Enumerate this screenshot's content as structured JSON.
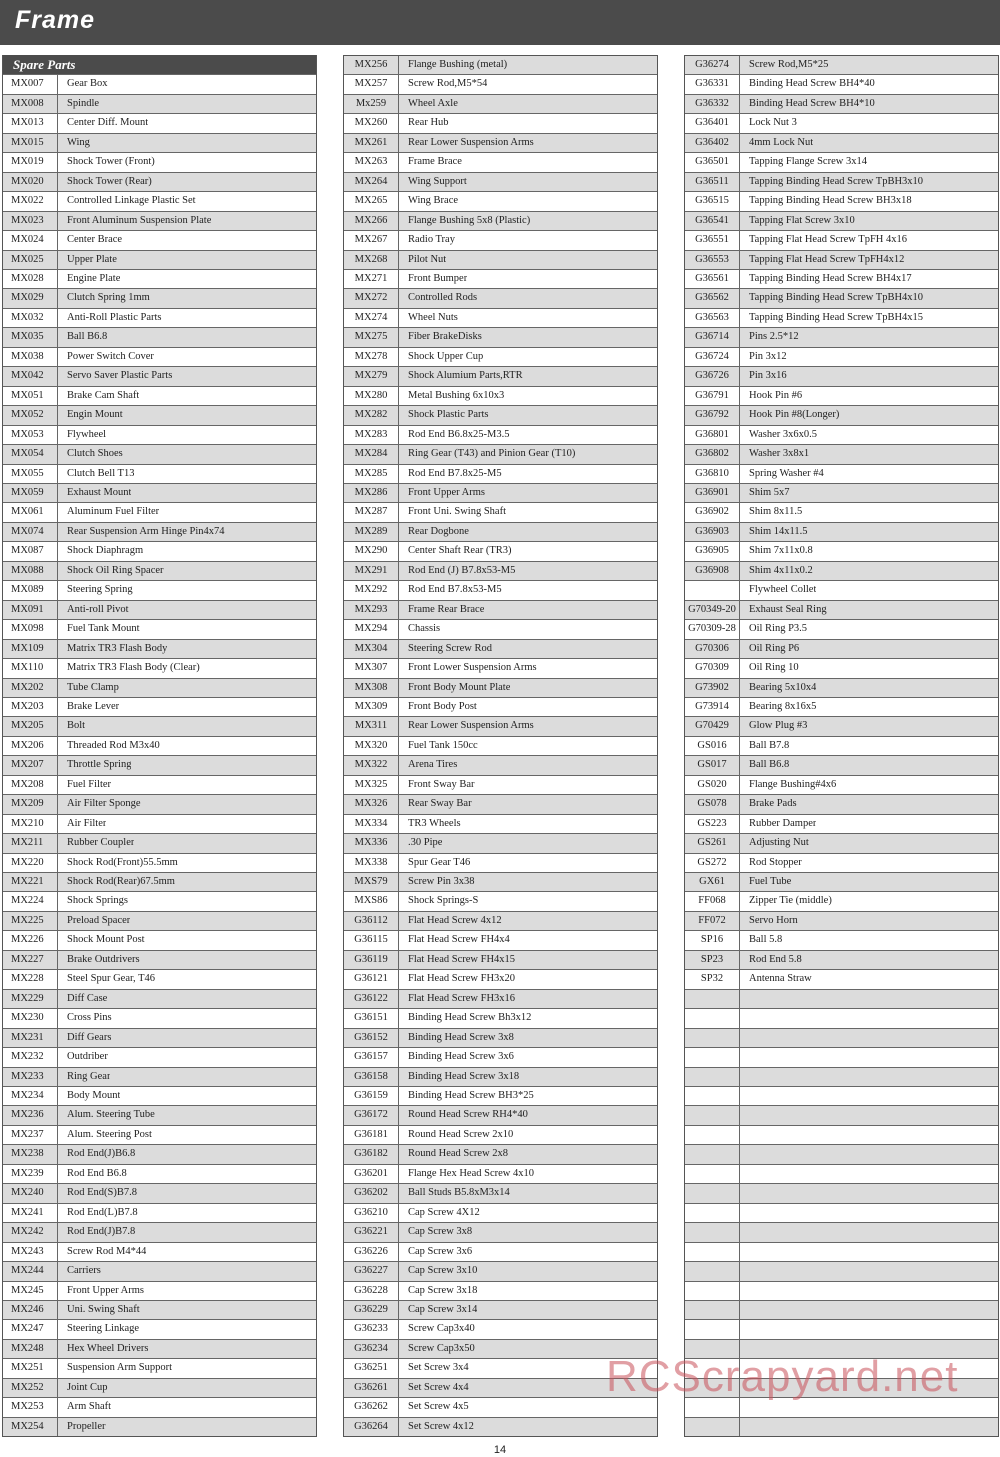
{
  "title": "Frame",
  "section_header": "Spare Parts",
  "page_number": "14",
  "watermark": "RCScrapyard.net",
  "colors": {
    "title_bar": "#4b4b4b",
    "row_shade": "#dcdcdc",
    "watermark": "#c8505a"
  },
  "columns": [
    [
      [
        "MX007",
        "Gear Box"
      ],
      [
        "MX008",
        "Spindle"
      ],
      [
        "MX013",
        "Center Diff. Mount"
      ],
      [
        "MX015",
        "Wing"
      ],
      [
        "MX019",
        "Shock Tower (Front)"
      ],
      [
        "MX020",
        "Shock Tower (Rear)"
      ],
      [
        "MX022",
        "Controlled Linkage Plastic Set"
      ],
      [
        "MX023",
        "Front Aluminum Suspension Plate"
      ],
      [
        "MX024",
        "Center Brace"
      ],
      [
        "MX025",
        "Upper Plate"
      ],
      [
        "MX028",
        "Engine Plate"
      ],
      [
        "MX029",
        "Clutch Spring 1mm"
      ],
      [
        "MX032",
        "Anti-Roll Plastic Parts"
      ],
      [
        "MX035",
        "Ball B6.8"
      ],
      [
        "MX038",
        "Power Switch Cover"
      ],
      [
        "MX042",
        "Servo Saver Plastic Parts"
      ],
      [
        "MX051",
        "Brake Cam Shaft"
      ],
      [
        "MX052",
        "Engin Mount"
      ],
      [
        "MX053",
        "Flywheel"
      ],
      [
        "MX054",
        "Clutch Shoes"
      ],
      [
        "MX055",
        "Clutch Bell T13"
      ],
      [
        "MX059",
        "Exhaust Mount"
      ],
      [
        "MX061",
        "Aluminum Fuel Filter"
      ],
      [
        "MX074",
        "Rear Suspension Arm Hinge Pin4x74"
      ],
      [
        "MX087",
        "Shock Diaphragm"
      ],
      [
        "MX088",
        "Shock Oil Ring Spacer"
      ],
      [
        "MX089",
        "Steering Spring"
      ],
      [
        "MX091",
        "Anti-roll Pivot"
      ],
      [
        "MX098",
        "Fuel Tank Mount"
      ],
      [
        "MX109",
        "Matrix TR3 Flash Body"
      ],
      [
        "MX110",
        "Matrix TR3 Flash Body (Clear)"
      ],
      [
        "MX202",
        "Tube Clamp"
      ],
      [
        "MX203",
        "Brake Lever"
      ],
      [
        "MX205",
        "Bolt"
      ],
      [
        "MX206",
        "Threaded Rod M3x40"
      ],
      [
        "MX207",
        "Throttle Spring"
      ],
      [
        "MX208",
        "Fuel Filter"
      ],
      [
        "MX209",
        "Air Filter Sponge"
      ],
      [
        "MX210",
        "Air Filter"
      ],
      [
        "MX211",
        "Rubber Coupler"
      ],
      [
        "MX220",
        "Shock Rod(Front)55.5mm"
      ],
      [
        "MX221",
        "Shock Rod(Rear)67.5mm"
      ],
      [
        "MX224",
        "Shock Springs"
      ],
      [
        "MX225",
        "Preload Spacer"
      ],
      [
        "MX226",
        "Shock Mount Post"
      ],
      [
        "MX227",
        "Brake Outdrivers"
      ],
      [
        "MX228",
        "Steel Spur Gear, T46"
      ],
      [
        "MX229",
        "Diff Case"
      ],
      [
        "MX230",
        "Cross Pins"
      ],
      [
        "MX231",
        "Diff Gears"
      ],
      [
        "MX232",
        "Outdriber"
      ],
      [
        "MX233",
        "Ring Gear"
      ],
      [
        "MX234",
        "Body Mount"
      ],
      [
        "MX236",
        "Alum. Steering Tube"
      ],
      [
        "MX237",
        "Alum. Steering Post"
      ],
      [
        "MX238",
        "Rod End(J)B6.8"
      ],
      [
        "MX239",
        "Rod End B6.8"
      ],
      [
        "MX240",
        "Rod End(S)B7.8"
      ],
      [
        "MX241",
        "Rod End(L)B7.8"
      ],
      [
        "MX242",
        "Rod End(J)B7.8"
      ],
      [
        "MX243",
        "Screw Rod M4*44"
      ],
      [
        "MX244",
        "Carriers"
      ],
      [
        "MX245",
        "Front Upper Arms"
      ],
      [
        "MX246",
        "Uni. Swing Shaft"
      ],
      [
        "MX247",
        "Steering Linkage"
      ],
      [
        "MX248",
        "Hex Wheel Drivers"
      ],
      [
        "MX251",
        "Suspension Arm Support"
      ],
      [
        "MX252",
        "Joint Cup"
      ],
      [
        "MX253",
        "Arm Shaft"
      ],
      [
        "MX254",
        "Propeller"
      ]
    ],
    [
      [
        "MX256",
        "Flange Bushing (metal)"
      ],
      [
        "MX257",
        "Screw Rod,M5*54"
      ],
      [
        "Mx259",
        "Wheel Axle"
      ],
      [
        "MX260",
        "Rear Hub"
      ],
      [
        "MX261",
        "Rear Lower Suspension Arms"
      ],
      [
        "MX263",
        "Frame Brace"
      ],
      [
        "MX264",
        "Wing Support"
      ],
      [
        "MX265",
        "Wing Brace"
      ],
      [
        "MX266",
        "Flange Bushing 5x8 (Plastic)"
      ],
      [
        "MX267",
        "Radio Tray"
      ],
      [
        "MX268",
        "Pilot Nut"
      ],
      [
        "MX271",
        "Front Bumper"
      ],
      [
        "MX272",
        "Controlled Rods"
      ],
      [
        "MX274",
        "Wheel Nuts"
      ],
      [
        "MX275",
        "Fiber BrakeDisks"
      ],
      [
        "MX278",
        "Shock Upper Cup"
      ],
      [
        "MX279",
        "Shock Alumium Parts,RTR"
      ],
      [
        "MX280",
        "Metal Bushing 6x10x3"
      ],
      [
        "MX282",
        "Shock Plastic Parts"
      ],
      [
        "MX283",
        "Rod End B6.8x25-M3.5"
      ],
      [
        "MX284",
        "Ring Gear (T43) and Pinion Gear (T10)"
      ],
      [
        "MX285",
        "Rod End B7.8x25-M5"
      ],
      [
        "MX286",
        "Front Upper Arms"
      ],
      [
        "MX287",
        "Front Uni. Swing Shaft"
      ],
      [
        "MX289",
        "Rear Dogbone"
      ],
      [
        "MX290",
        "Center Shaft Rear (TR3)"
      ],
      [
        "MX291",
        "Rod End (J) B7.8x53-M5"
      ],
      [
        "MX292",
        "Rod End B7.8x53-M5"
      ],
      [
        "MX293",
        "Frame Rear Brace"
      ],
      [
        "MX294",
        "Chassis"
      ],
      [
        "MX304",
        "Steering Screw Rod"
      ],
      [
        "MX307",
        "Front Lower Suspension Arms"
      ],
      [
        "MX308",
        "Front Body Mount  Plate"
      ],
      [
        "MX309",
        "Front Body Post"
      ],
      [
        "MX311",
        "Rear Lower Suspension Arms"
      ],
      [
        "MX320",
        "Fuel Tank 150cc"
      ],
      [
        "MX322",
        "Arena Tires"
      ],
      [
        "MX325",
        "Front Sway Bar"
      ],
      [
        "MX326",
        "Rear Sway Bar"
      ],
      [
        "MX334",
        "TR3 Wheels"
      ],
      [
        "MX336",
        ".30 Pipe"
      ],
      [
        "MX338",
        "Spur Gear T46"
      ],
      [
        "MXS79",
        "Screw Pin 3x38"
      ],
      [
        "MXS86",
        "Shock Springs-S"
      ],
      [
        "G36112",
        "Flat Head Screw 4x12"
      ],
      [
        "G36115",
        "Flat Head Screw FH4x4"
      ],
      [
        "G36119",
        "Flat Head Screw FH4x15"
      ],
      [
        "G36121",
        "Flat Head Screw FH3x20"
      ],
      [
        "G36122",
        "Flat Head Screw FH3x16"
      ],
      [
        "G36151",
        "Binding Head Screw Bh3x12"
      ],
      [
        "G36152",
        "Binding Head Screw 3x8"
      ],
      [
        "G36157",
        "Binding Head Screw 3x6"
      ],
      [
        "G36158",
        "Binding Head Screw 3x18"
      ],
      [
        "G36159",
        "Binding Head Screw BH3*25"
      ],
      [
        "G36172",
        "Round Head Screw RH4*40"
      ],
      [
        "G36181",
        "Round Head Screw 2x10"
      ],
      [
        "G36182",
        "Round Head Screw 2x8"
      ],
      [
        "G36201",
        "Flange Hex Head Screw 4x10"
      ],
      [
        "G36202",
        "Ball Studs B5.8xM3x14"
      ],
      [
        "G36210",
        "Cap Screw 4X12"
      ],
      [
        "G36221",
        "Cap Screw 3x8"
      ],
      [
        "G36226",
        "Cap Screw 3x6"
      ],
      [
        "G36227",
        "Cap Screw 3x10"
      ],
      [
        "G36228",
        "Cap Screw 3x18"
      ],
      [
        "G36229",
        "Cap Screw 3x14"
      ],
      [
        "G36233",
        "Screw Cap3x40"
      ],
      [
        "G36234",
        "Screw Cap3x50"
      ],
      [
        "G36251",
        "Set Screw 3x4"
      ],
      [
        "G36261",
        "Set Screw 4x4"
      ],
      [
        "G36262",
        "Set Screw 4x5"
      ],
      [
        "G36264",
        "Set Screw 4x12"
      ]
    ],
    [
      [
        "G36274",
        "Screw Rod,M5*25"
      ],
      [
        "G36331",
        "Binding Head Screw BH4*40"
      ],
      [
        "G36332",
        "Binding Head Screw BH4*10"
      ],
      [
        "G36401",
        "Lock Nut 3"
      ],
      [
        "G36402",
        "4mm Lock Nut"
      ],
      [
        "G36501",
        "Tapping Flange Screw 3x14"
      ],
      [
        "G36511",
        "Tapping Binding Head Screw TpBH3x10"
      ],
      [
        "G36515",
        "Tapping Binding Head Screw BH3x18"
      ],
      [
        "G36541",
        "Tapping Flat Screw 3x10"
      ],
      [
        "G36551",
        "Tapping Flat Head Screw TpFH 4x16"
      ],
      [
        "G36553",
        "Tapping Flat Head Screw TpFH4x12"
      ],
      [
        "G36561",
        "Tapping Binding Head Screw BH4x17"
      ],
      [
        "G36562",
        "Tapping Binding Head Screw TpBH4x10"
      ],
      [
        "G36563",
        "Tapping  Binding Head Screw TpBH4x15"
      ],
      [
        "G36714",
        "Pins 2.5*12"
      ],
      [
        "G36724",
        "Pin 3x12"
      ],
      [
        "G36726",
        "Pin 3x16"
      ],
      [
        "G36791",
        "Hook Pin #6"
      ],
      [
        "G36792",
        "Hook Pin #8(Longer)"
      ],
      [
        "G36801",
        "Washer 3x6x0.5"
      ],
      [
        "G36802",
        "Washer 3x8x1"
      ],
      [
        "G36810",
        "Spring Washer #4"
      ],
      [
        "G36901",
        "Shim 5x7"
      ],
      [
        "G36902",
        "Shim 8x11.5"
      ],
      [
        "G36903",
        "Shim 14x11.5"
      ],
      [
        "G36905",
        "Shim 7x11x0.8"
      ],
      [
        "G36908",
        "Shim 4x11x0.2"
      ],
      [
        "",
        "Flywheel Collet"
      ],
      [
        "G70349-20",
        "Exhaust Seal Ring"
      ],
      [
        "G70309-28",
        "Oil Ring P3.5"
      ],
      [
        "G70306",
        "Oil Ring P6"
      ],
      [
        "G70309",
        "Oil Ring 10"
      ],
      [
        "G73902",
        "Bearing 5x10x4"
      ],
      [
        "G73914",
        "Bearing 8x16x5"
      ],
      [
        "G70429",
        "Glow Plug #3"
      ],
      [
        "GS016",
        "Ball B7.8"
      ],
      [
        "GS017",
        "Ball B6.8"
      ],
      [
        "GS020",
        "Flange Bushing#4x6"
      ],
      [
        "GS078",
        "Brake Pads"
      ],
      [
        "GS223",
        "Rubber  Damper"
      ],
      [
        "GS261",
        "Adjusting Nut"
      ],
      [
        "GS272",
        "Rod Stopper"
      ],
      [
        "GX61",
        "Fuel Tube"
      ],
      [
        "FF068",
        "Zipper Tie (middle)"
      ],
      [
        "FF072",
        "Servo Horn"
      ],
      [
        "SP16",
        "Ball 5.8"
      ],
      [
        "SP23",
        "Rod End 5.8"
      ],
      [
        "SP32",
        "Antenna Straw"
      ],
      [
        "",
        ""
      ],
      [
        "",
        ""
      ],
      [
        "",
        ""
      ],
      [
        "",
        ""
      ],
      [
        "",
        ""
      ],
      [
        "",
        ""
      ],
      [
        "",
        ""
      ],
      [
        "",
        ""
      ],
      [
        "",
        ""
      ],
      [
        "",
        ""
      ],
      [
        "",
        ""
      ],
      [
        "",
        ""
      ],
      [
        "",
        ""
      ],
      [
        "",
        ""
      ],
      [
        "",
        ""
      ],
      [
        "",
        ""
      ],
      [
        "",
        ""
      ],
      [
        "",
        ""
      ],
      [
        "",
        ""
      ],
      [
        "",
        ""
      ],
      [
        "",
        ""
      ],
      [
        "",
        ""
      ],
      [
        "",
        ""
      ]
    ]
  ]
}
